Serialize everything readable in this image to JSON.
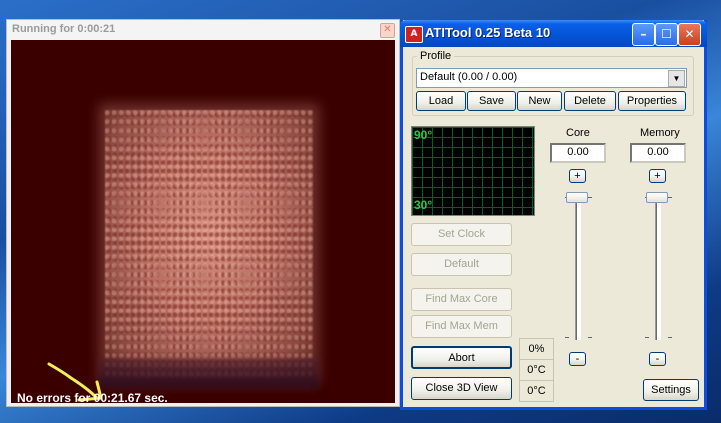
{
  "render_window": {
    "title": "Running for 0:00:21",
    "close_glyph": "✕",
    "status": "No errors for 00:21.67 sec."
  },
  "atitool": {
    "title": "ATITool 0.25 Beta 10",
    "logo_text": "A",
    "titlebar_buttons": {
      "minimize": "–",
      "maximize": "☐",
      "close": "✕"
    },
    "profile": {
      "label": "Profile",
      "selected": "Default (0.00 / 0.00)",
      "buttons": [
        "Load",
        "Save",
        "New",
        "Delete",
        "Properties"
      ]
    },
    "graph": {
      "top_label": "90°",
      "bottom_label": "30°"
    },
    "left_buttons": {
      "set_clock": "Set Clock",
      "default": "Default",
      "find_max_core": "Find Max Core",
      "find_max_mem": "Find Max Mem",
      "abort": "Abort",
      "close_3d": "Close 3D View"
    },
    "readouts": [
      "0%",
      "0°C",
      "0°C"
    ],
    "core": {
      "label": "Core",
      "value": "0.00",
      "plus": "+",
      "minus": "-"
    },
    "memory": {
      "label": "Memory",
      "value": "0.00",
      "plus": "+",
      "minus": "-"
    },
    "settings": "Settings"
  },
  "colors": {
    "canvas_bg": "#3a0000",
    "fur": "#c47d70",
    "graph_text": "#22d13a",
    "xp_blue": "#0454d6"
  }
}
